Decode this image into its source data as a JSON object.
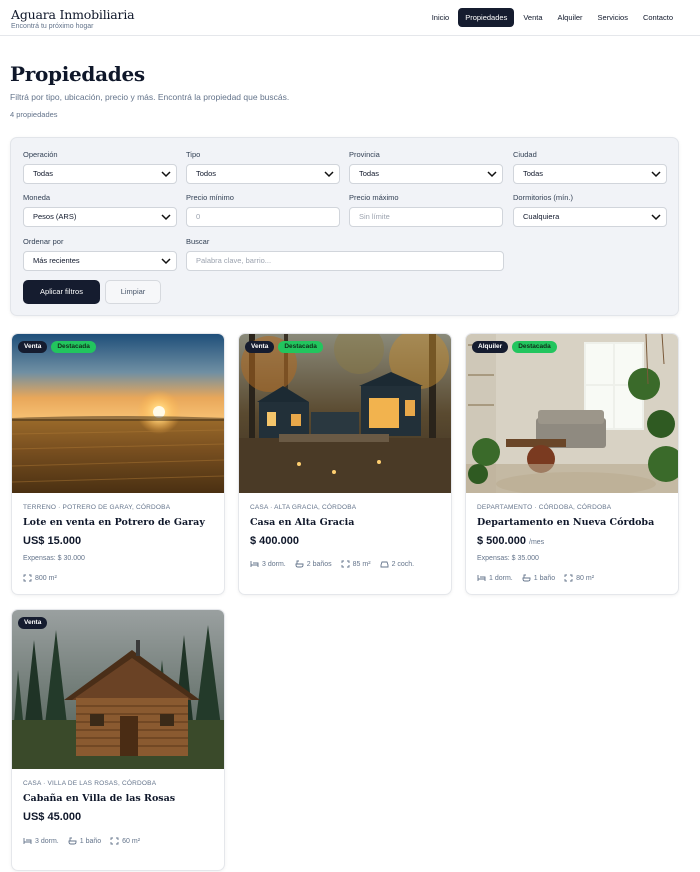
{
  "header": {
    "brand_name": "Aguara Inmobiliaria",
    "brand_tagline": "Encontrá tu próximo hogar",
    "nav": [
      {
        "label": "Inicio",
        "active": false
      },
      {
        "label": "Propiedades",
        "active": true
      },
      {
        "label": "Venta",
        "active": false
      },
      {
        "label": "Alquiler",
        "active": false
      },
      {
        "label": "Servicios",
        "active": false
      },
      {
        "label": "Contacto",
        "active": false
      }
    ]
  },
  "page": {
    "title": "Propiedades",
    "subtitle": "Filtrá por tipo, ubicación, precio y más. Encontrá la propiedad que buscás.",
    "count": "4 propiedades"
  },
  "filters": {
    "operacion": {
      "label": "Operación",
      "value": "Todas"
    },
    "tipo": {
      "label": "Tipo",
      "value": "Todos"
    },
    "provincia": {
      "label": "Provincia",
      "value": "Todas"
    },
    "ciudad": {
      "label": "Ciudad",
      "value": "Todas"
    },
    "moneda": {
      "label": "Moneda",
      "value": "Pesos (ARS)"
    },
    "precio_min": {
      "label": "Precio mínimo",
      "placeholder": "0"
    },
    "precio_max": {
      "label": "Precio máximo",
      "placeholder": "Sin límite"
    },
    "dormitorios": {
      "label": "Dormitorios (mín.)",
      "value": "Cualquiera"
    },
    "orden": {
      "label": "Ordenar por",
      "value": "Más recientes"
    },
    "buscar": {
      "label": "Buscar",
      "placeholder": "Palabra clave, barrio..."
    },
    "apply_label": "Aplicar filtros",
    "clear_label": "Limpiar"
  },
  "listings": [
    {
      "operation": "Venta",
      "featured": "Destacada",
      "location": "TERRENO · POTRERO DE GARAY, CÓRDOBA",
      "title": "Lote en venta en Potrero de Garay",
      "price": "US$ 15.000",
      "expenses": "Expensas: $ 30.000",
      "area": "800 m²",
      "image_icon": "sunset-field-photo"
    },
    {
      "operation": "Venta",
      "featured": "Destacada",
      "location": "CASA · ALTA GRACIA, CÓRDOBA",
      "title": "Casa en Alta Gracia",
      "price": "$ 400.000",
      "bedrooms": "3 dorm.",
      "bathrooms": "2 baños",
      "area": "85 m²",
      "garage": "2 coch.",
      "image_icon": "forest-house-photo"
    },
    {
      "operation": "Alquiler",
      "featured": "Destacada",
      "location": "DEPARTAMENTO · CÓRDOBA, CÓRDOBA",
      "title": "Departamento en Nueva Córdoba",
      "price": "$ 500.000",
      "price_period": "/mes",
      "expenses": "Expensas: $ 35.000",
      "bedrooms": "1 dorm.",
      "bathrooms": "1 baño",
      "area": "80 m²",
      "image_icon": "living-room-photo"
    },
    {
      "operation": "Venta",
      "location": "CASA · VILLA DE LAS ROSAS, CÓRDOBA",
      "title": "Cabaña en Villa de las Rosas",
      "price": "US$ 45.000",
      "bedrooms": "3 dorm.",
      "bathrooms": "1 baño",
      "area": "60 m²",
      "image_icon": "log-cabin-photo"
    }
  ],
  "colors": {
    "primary": "#151c2f",
    "featured": "#22c55e",
    "muted": "#64748b",
    "panel": "#f1f3f7"
  }
}
